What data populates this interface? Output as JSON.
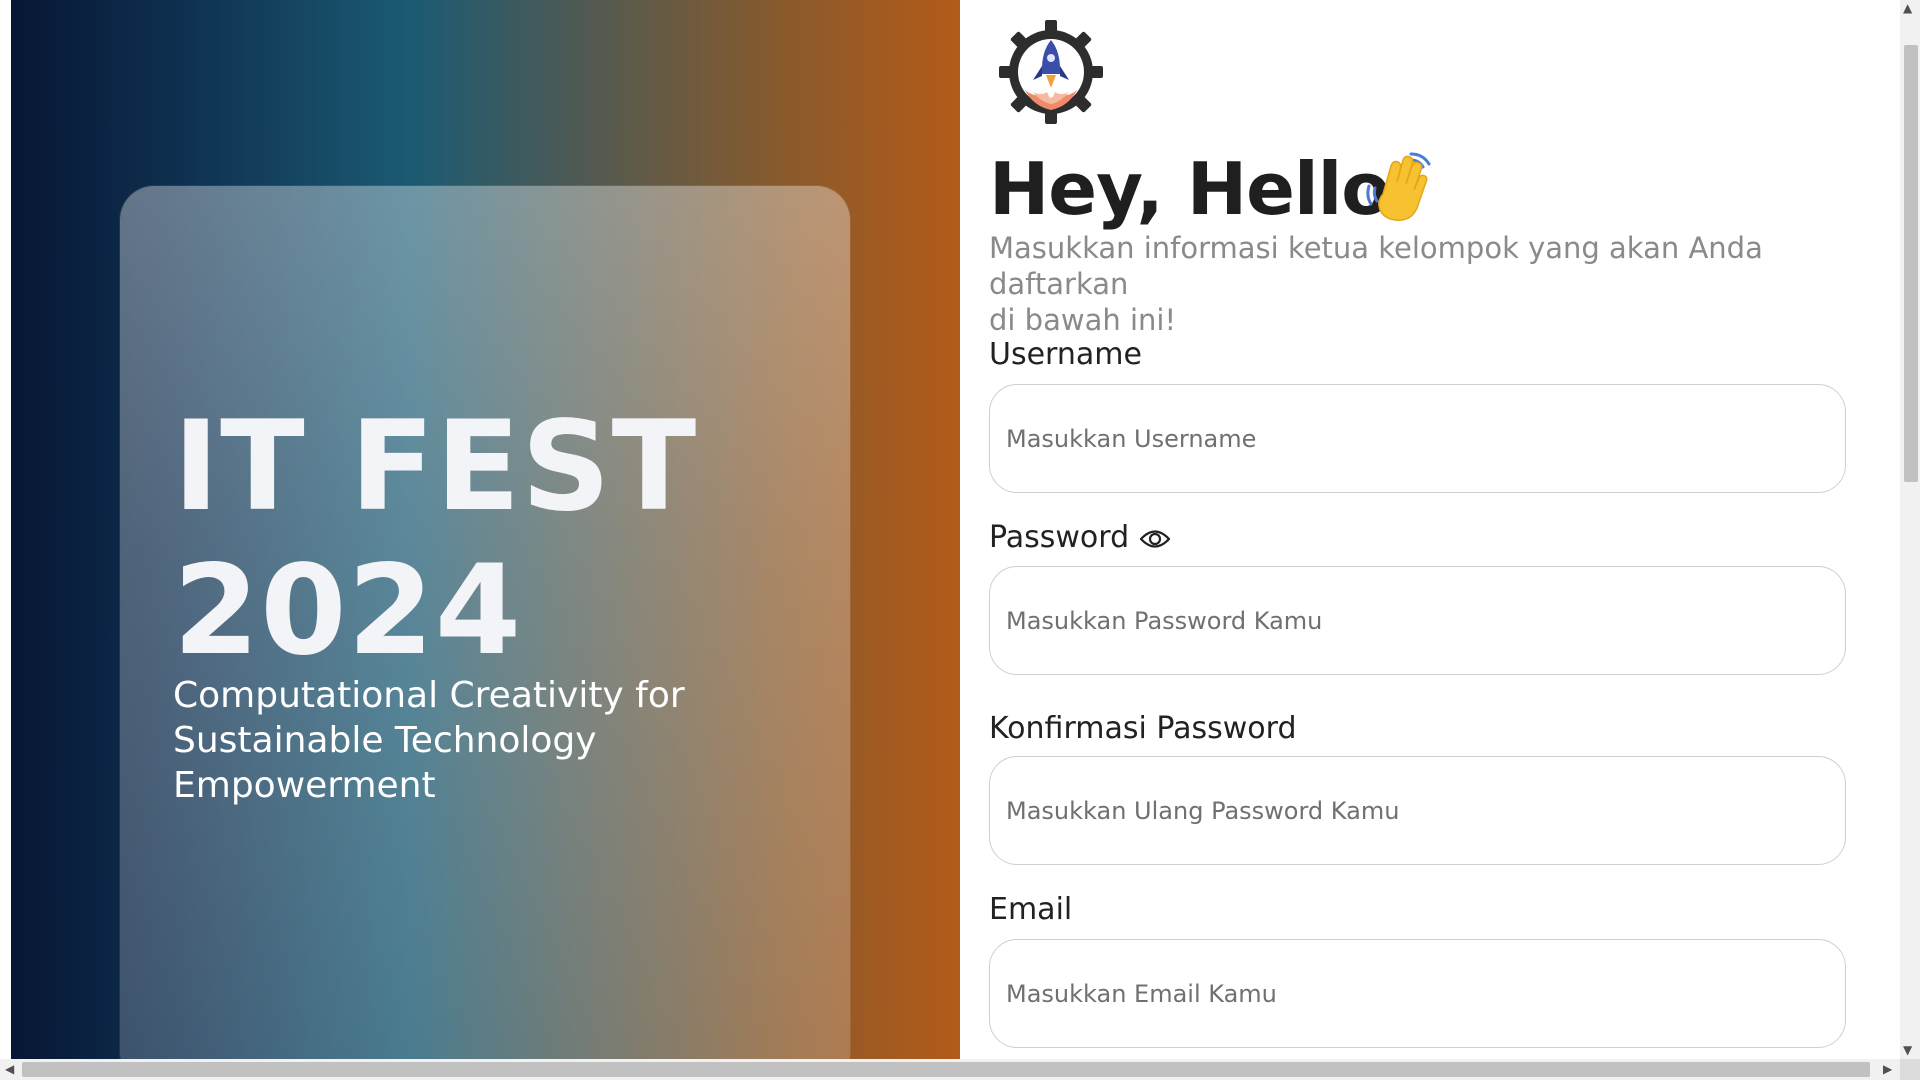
{
  "hero": {
    "title_line1": "IT FEST",
    "title_line2": "2024",
    "subtitle": "Computational Creativity for Sustainable Technology Empowerment"
  },
  "form": {
    "logo_icon": "rocket-gear-logo",
    "greeting": "Hey, Hello",
    "greeting_icon": "waving-hand-icon",
    "intro_line1": "Masukkan informasi ketua kelompok yang akan Anda daftarkan",
    "intro_line2": "di bawah ini!",
    "username_label": "Username",
    "username_placeholder": "Masukkan Username",
    "password_label": "Password",
    "password_icon": "eye-icon",
    "password_placeholder": "Masukkan Password Kamu",
    "confirm_label": "Konfirmasi Password",
    "confirm_placeholder": "Masukkan Ulang Password Kamu",
    "email_label": "Email",
    "email_placeholder": "Masukkan Email Kamu"
  },
  "colors": {
    "hero_start": "#071634",
    "hero_mid": "#1b5a73",
    "hero_end": "#b35b1a",
    "label_text": "#222222",
    "intro_text": "#8a8a8a"
  },
  "scrollbars": {
    "up_arrow": "▲",
    "down_arrow": "▼",
    "left_arrow": "◀",
    "right_arrow": "▶"
  }
}
